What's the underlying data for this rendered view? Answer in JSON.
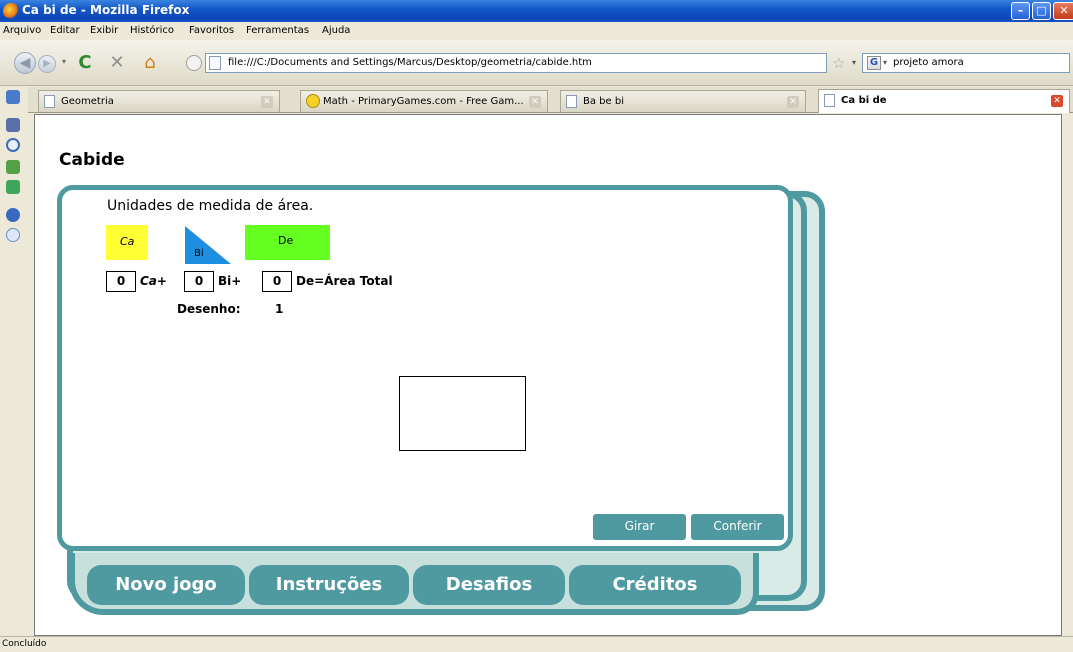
{
  "window": {
    "title": "Ca bi de - Mozilla Firefox",
    "min": "–",
    "max": "□",
    "close": "✕"
  },
  "menu": [
    "Arquivo",
    "Editar",
    "Exibir",
    "Histórico",
    "Favoritos",
    "Ferramentas",
    "Ajuda"
  ],
  "nav": {
    "back": "◀",
    "forward": "▶",
    "dropdown": "▾",
    "reload": "C",
    "stop": "✕",
    "home": "⌂",
    "url": "file:///C:/Documents and Settings/Marcus/Desktop/geometria/cabide.htm",
    "star": "☆",
    "search_engine": "G",
    "search_value": "projeto amora"
  },
  "tabs": [
    {
      "label": "Geometria",
      "close": "✕",
      "active": false
    },
    {
      "label": "Math - PrimaryGames.com - Free Gam...",
      "close": "✕",
      "active": false
    },
    {
      "label": "Ba be bi",
      "close": "✕",
      "active": false
    },
    {
      "label": "Ca bi de",
      "close": "✕",
      "active": true
    }
  ],
  "page": {
    "title": "Cabide",
    "panel_title": "Unidades de medida de área.",
    "pieces": {
      "ca": "Ca",
      "bi": "Bi",
      "de": "De"
    },
    "inputs": {
      "ca": "0",
      "bi": "0",
      "de": "0"
    },
    "equation": {
      "ca": "Ca+",
      "bi": "Bi+",
      "de": "De=Área Total"
    },
    "desenho_label": "Desenho:",
    "desenho_value": "1",
    "buttons": {
      "girar": "Girar",
      "conferir": "Conferir"
    },
    "nav_tabs": {
      "novo": "Novo jogo",
      "instrucoes": "Instruções",
      "desafios": "Desafios",
      "creditos": "Créditos"
    }
  },
  "status": "Concluído",
  "colors": {
    "teal": "#4f9aa0",
    "yellow_piece": "#ffff33",
    "blue_piece": "#1e8fe0",
    "green_piece": "#66ff22"
  }
}
